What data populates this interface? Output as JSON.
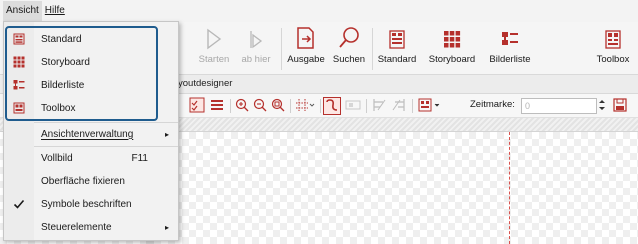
{
  "menubar": {
    "items": [
      {
        "label": "Ansicht",
        "active": true
      },
      {
        "label": "Hilfe",
        "active": false
      }
    ]
  },
  "ribbon": {
    "buttons": [
      {
        "label": "Starten",
        "icon": "play-icon",
        "enabled": false
      },
      {
        "label": "ab hier",
        "icon": "play-from-here-icon",
        "enabled": false
      },
      {
        "label": "Ausgabe",
        "icon": "export-icon",
        "enabled": true
      },
      {
        "label": "Suchen",
        "icon": "search-icon",
        "enabled": true
      },
      {
        "label": "Standard",
        "icon": "standard-view-icon",
        "enabled": true
      },
      {
        "label": "Storyboard",
        "icon": "storyboard-icon",
        "enabled": true
      },
      {
        "label": "Bilderliste",
        "icon": "image-list-icon",
        "enabled": true
      },
      {
        "label": "Toolbox",
        "icon": "toolbox-icon",
        "enabled": true
      }
    ]
  },
  "tabbar": {
    "tab_label": "youtdesigner"
  },
  "toolbar": {
    "zeitmarke_label": "Zeitmarke:",
    "zeitmarke_value": "0"
  },
  "dropdown": {
    "items": [
      {
        "label": "Standard",
        "icon": "standard-view-icon"
      },
      {
        "label": "Storyboard",
        "icon": "storyboard-icon"
      },
      {
        "label": "Bilderliste",
        "icon": "image-list-icon"
      },
      {
        "label": "Toolbox",
        "icon": "toolbox-icon"
      },
      {
        "label": "Ansichtenverwaltung",
        "submenu": true
      },
      {
        "label": "Vollbild",
        "shortcut": "F11"
      },
      {
        "label": "Oberfläche fixieren"
      },
      {
        "label": "Symbole beschriften",
        "checked": true
      },
      {
        "label": "Steuerelemente",
        "submenu": true
      }
    ]
  },
  "colors": {
    "accent_red": "#b5302c",
    "highlight_blue": "#1f5c8e",
    "disabled_gray": "#a8a8a8"
  }
}
